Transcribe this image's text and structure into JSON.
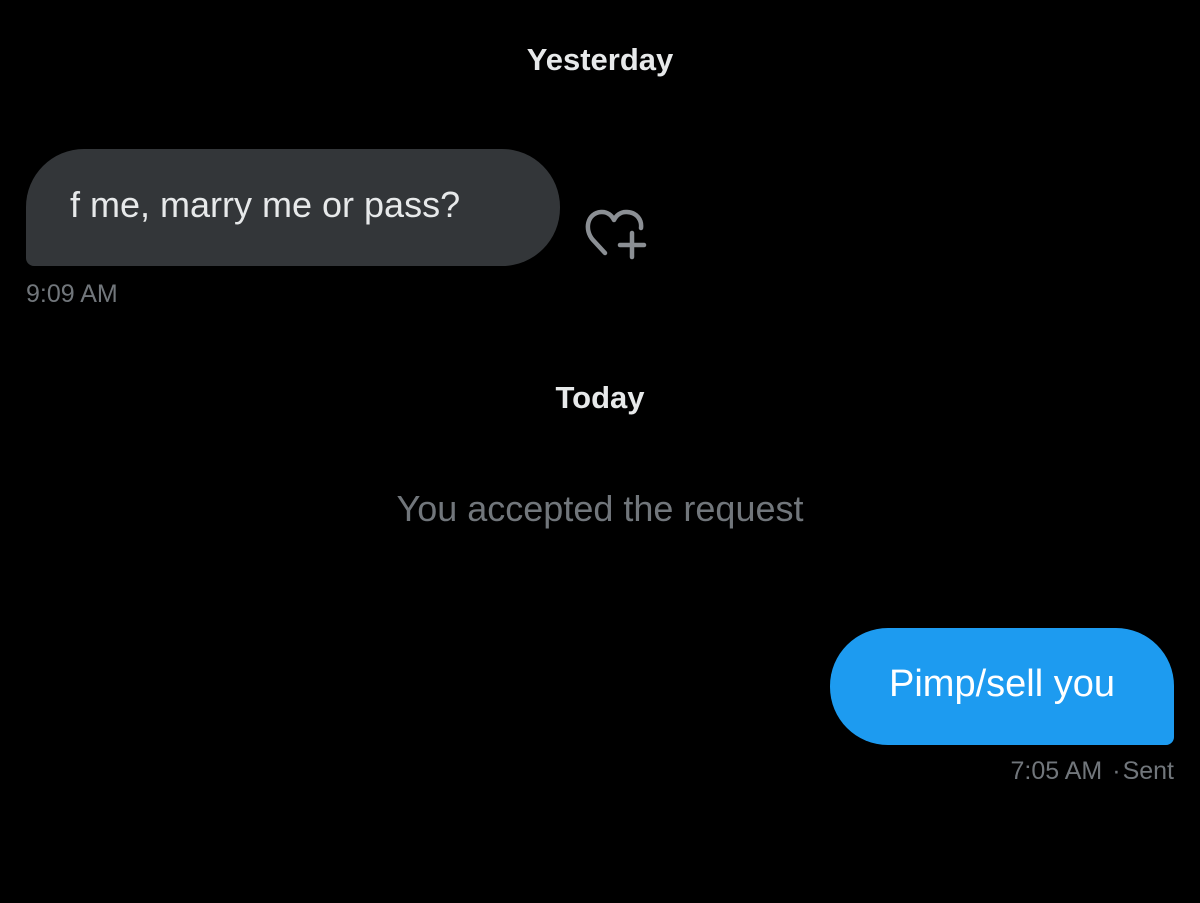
{
  "conversation": {
    "dividers": {
      "yesterday": "Yesterday",
      "today": "Today"
    },
    "incoming_message": {
      "text": "f me, marry me or pass?",
      "time": "9:09 AM",
      "react_icon": "heart-plus-icon"
    },
    "system_message": "You accepted the request",
    "outgoing_message": {
      "text": "Pimp/sell you",
      "time": "7:05 AM",
      "separator": "·",
      "status": "Sent"
    }
  },
  "colors": {
    "background": "#000000",
    "incoming_bubble": "#333639",
    "outgoing_bubble": "#1d9bf0",
    "primary_text": "#e7e9ea",
    "secondary_text": "#71767b"
  }
}
